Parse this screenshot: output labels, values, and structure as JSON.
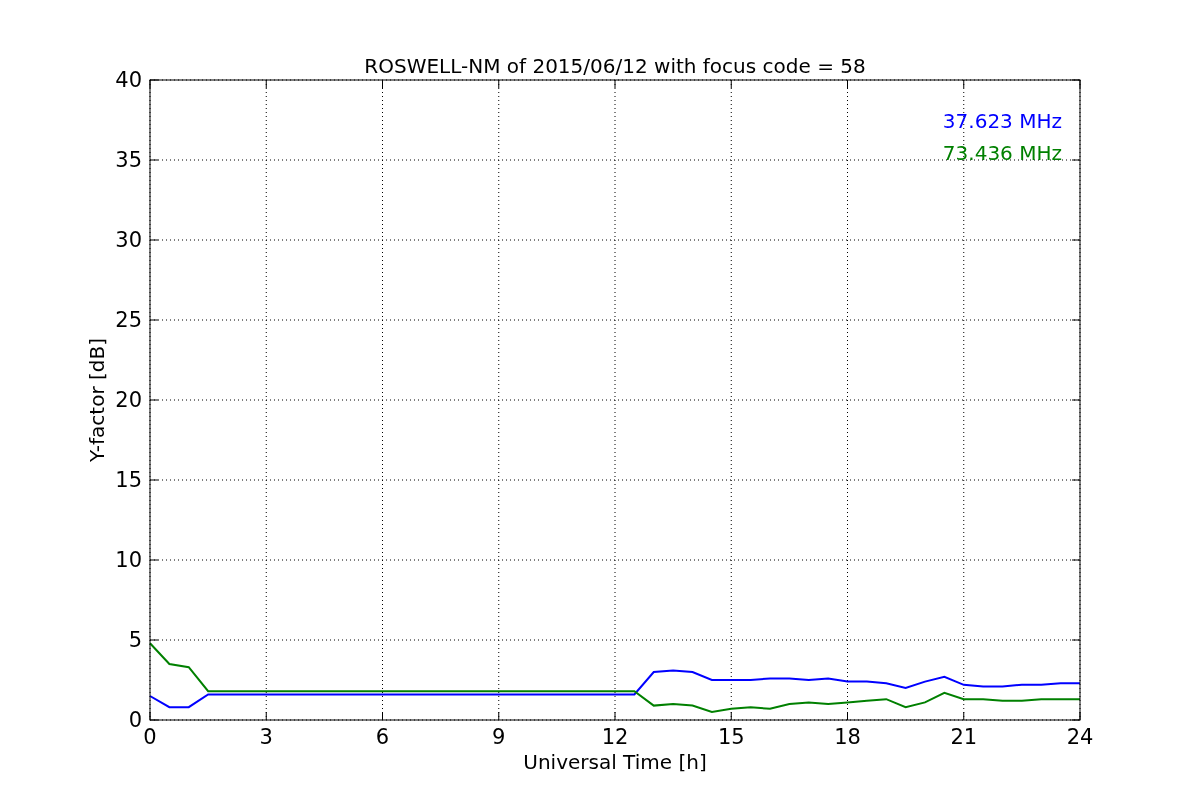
{
  "figure": {
    "chart_data": {
      "type": "line",
      "title": "ROSWELL-NM of 2015/06/12 with focus code = 58",
      "xlabel": "Universal Time [h]",
      "ylabel": "Y-factor [dB]",
      "x": [
        0,
        0.5,
        1,
        1.5,
        2,
        2.5,
        3,
        3.5,
        4,
        4.5,
        5,
        5.5,
        6,
        6.5,
        7,
        7.5,
        8,
        8.5,
        9,
        9.5,
        10,
        10.5,
        11,
        11.5,
        12,
        12.5,
        13,
        13.5,
        14,
        14.5,
        15,
        15.5,
        16,
        16.5,
        17,
        17.5,
        18,
        18.5,
        19,
        19.5,
        20,
        20.5,
        21,
        21.5,
        22,
        22.5,
        23,
        23.5,
        24
      ],
      "series": [
        {
          "name": "37.623 MHz",
          "color": "#0000ff",
          "values": [
            1.5,
            0.8,
            0.8,
            1.6,
            1.6,
            1.6,
            1.6,
            1.6,
            1.6,
            1.6,
            1.6,
            1.6,
            1.6,
            1.6,
            1.6,
            1.6,
            1.6,
            1.6,
            1.6,
            1.6,
            1.6,
            1.6,
            1.6,
            1.6,
            1.6,
            1.6,
            3.0,
            3.1,
            3.0,
            2.5,
            2.5,
            2.5,
            2.6,
            2.6,
            2.5,
            2.6,
            2.4,
            2.4,
            2.3,
            2.0,
            2.4,
            2.7,
            2.2,
            2.1,
            2.1,
            2.2,
            2.2,
            2.3,
            2.3
          ]
        },
        {
          "name": "73.436 MHz",
          "color": "#008000",
          "values": [
            4.8,
            3.5,
            3.3,
            1.8,
            1.8,
            1.8,
            1.8,
            1.8,
            1.8,
            1.8,
            1.8,
            1.8,
            1.8,
            1.8,
            1.8,
            1.8,
            1.8,
            1.8,
            1.8,
            1.8,
            1.8,
            1.8,
            1.8,
            1.8,
            1.8,
            1.8,
            0.9,
            1.0,
            0.9,
            0.5,
            0.7,
            0.8,
            0.7,
            1.0,
            1.1,
            1.0,
            1.1,
            1.2,
            1.3,
            0.8,
            1.1,
            1.7,
            1.3,
            1.3,
            1.2,
            1.2,
            1.3,
            1.3,
            1.3
          ]
        }
      ],
      "xlim": [
        0,
        24
      ],
      "ylim": [
        0,
        40
      ],
      "xticks": [
        0,
        3,
        6,
        9,
        12,
        15,
        18,
        21,
        24
      ],
      "yticks": [
        0,
        5,
        10,
        15,
        20,
        25,
        30,
        35,
        40
      ],
      "grid": true
    }
  }
}
